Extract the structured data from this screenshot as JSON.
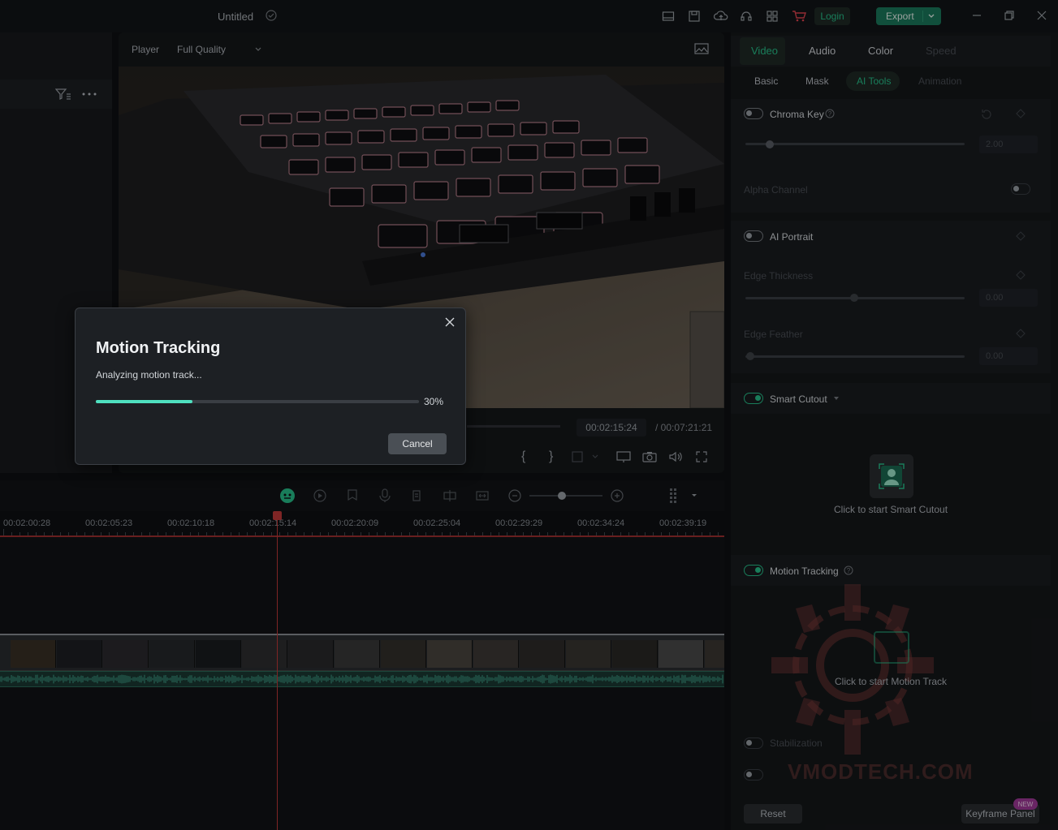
{
  "titlebar": {
    "title": "Untitled",
    "login": "Login",
    "export": "Export"
  },
  "player": {
    "label": "Player",
    "quality": "Full Quality",
    "current_time": "00:02:15:24",
    "total_time": "/ 00:07:21:21"
  },
  "timeline": {
    "ruler": [
      "00:02:00:28",
      "00:02:05:23",
      "00:02:10:18",
      "00:02:15:14",
      "00:02:20:09",
      "00:02:25:04",
      "00:02:29:29",
      "00:02:34:24",
      "00:02:39:19"
    ]
  },
  "right": {
    "tabs": [
      "Video",
      "Audio",
      "Color",
      "Speed"
    ],
    "subtabs": [
      "Basic",
      "Mask",
      "AI Tools",
      "Animation"
    ],
    "chroma_key": "Chroma Key",
    "chroma_value": "2.00",
    "alpha_channel": "Alpha Channel",
    "ai_portrait": "AI Portrait",
    "edge_thickness": "Edge Thickness",
    "edge_thickness_value": "0.00",
    "edge_feather": "Edge Feather",
    "edge_feather_value": "0.00",
    "smart_cutout": "Smart Cutout",
    "smart_cutout_hint": "Click to start Smart Cutout",
    "motion_tracking": "Motion Tracking",
    "motion_tracking_hint": "Click to start Motion Track",
    "stabilization": "Stabilization",
    "reset": "Reset",
    "keyframe_panel": "Keyframe Panel",
    "new_badge": "NEW"
  },
  "dialog": {
    "title": "Motion Tracking",
    "message": "Analyzing motion track...",
    "progress": 0.3,
    "progress_label": "30%",
    "cancel": "Cancel"
  },
  "watermark": "VMODTECH.COM",
  "colors": {
    "accent": "#27c08a",
    "progress": "#4fe0c0",
    "playhead": "#c43a3a"
  }
}
